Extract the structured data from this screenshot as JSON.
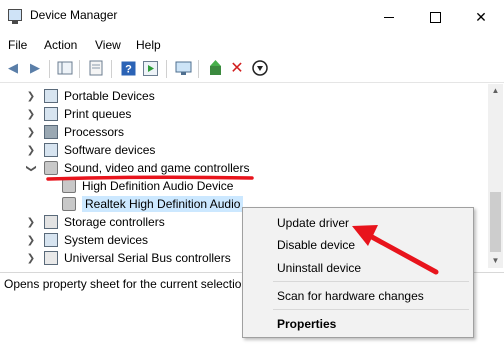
{
  "window": {
    "title": "Device Manager"
  },
  "menu": [
    "File",
    "Action",
    "View",
    "Help"
  ],
  "toolbar_icons": [
    "back-icon",
    "forward-icon",
    "show-hide-tree-icon",
    "properties-icon",
    "help-icon",
    "action-pane-icon",
    "scan-hardware-icon",
    "update-driver-icon",
    "uninstall-icon",
    "disable-icon"
  ],
  "tree": [
    {
      "label": "Portable Devices",
      "expanded": false
    },
    {
      "label": "Print queues",
      "expanded": false
    },
    {
      "label": "Processors",
      "expanded": false
    },
    {
      "label": "Software devices",
      "expanded": false
    },
    {
      "label": "Sound, video and game controllers",
      "expanded": true
    },
    {
      "label": "High Definition Audio Device",
      "child": true
    },
    {
      "label": "Realtek High Definition Audio",
      "child": true,
      "selected": true
    },
    {
      "label": "Storage controllers",
      "expanded": false
    },
    {
      "label": "System devices",
      "expanded": false
    },
    {
      "label": "Universal Serial Bus controllers",
      "expanded": false
    }
  ],
  "status": "Opens property sheet for the current selection",
  "context_menu": {
    "update_driver": "Update driver",
    "disable_device": "Disable device",
    "uninstall_device": "Uninstall device",
    "scan": "Scan for hardware changes",
    "properties": "Properties"
  },
  "colors": {
    "annotation": "#e8141c",
    "selection": "#cce8ff"
  }
}
